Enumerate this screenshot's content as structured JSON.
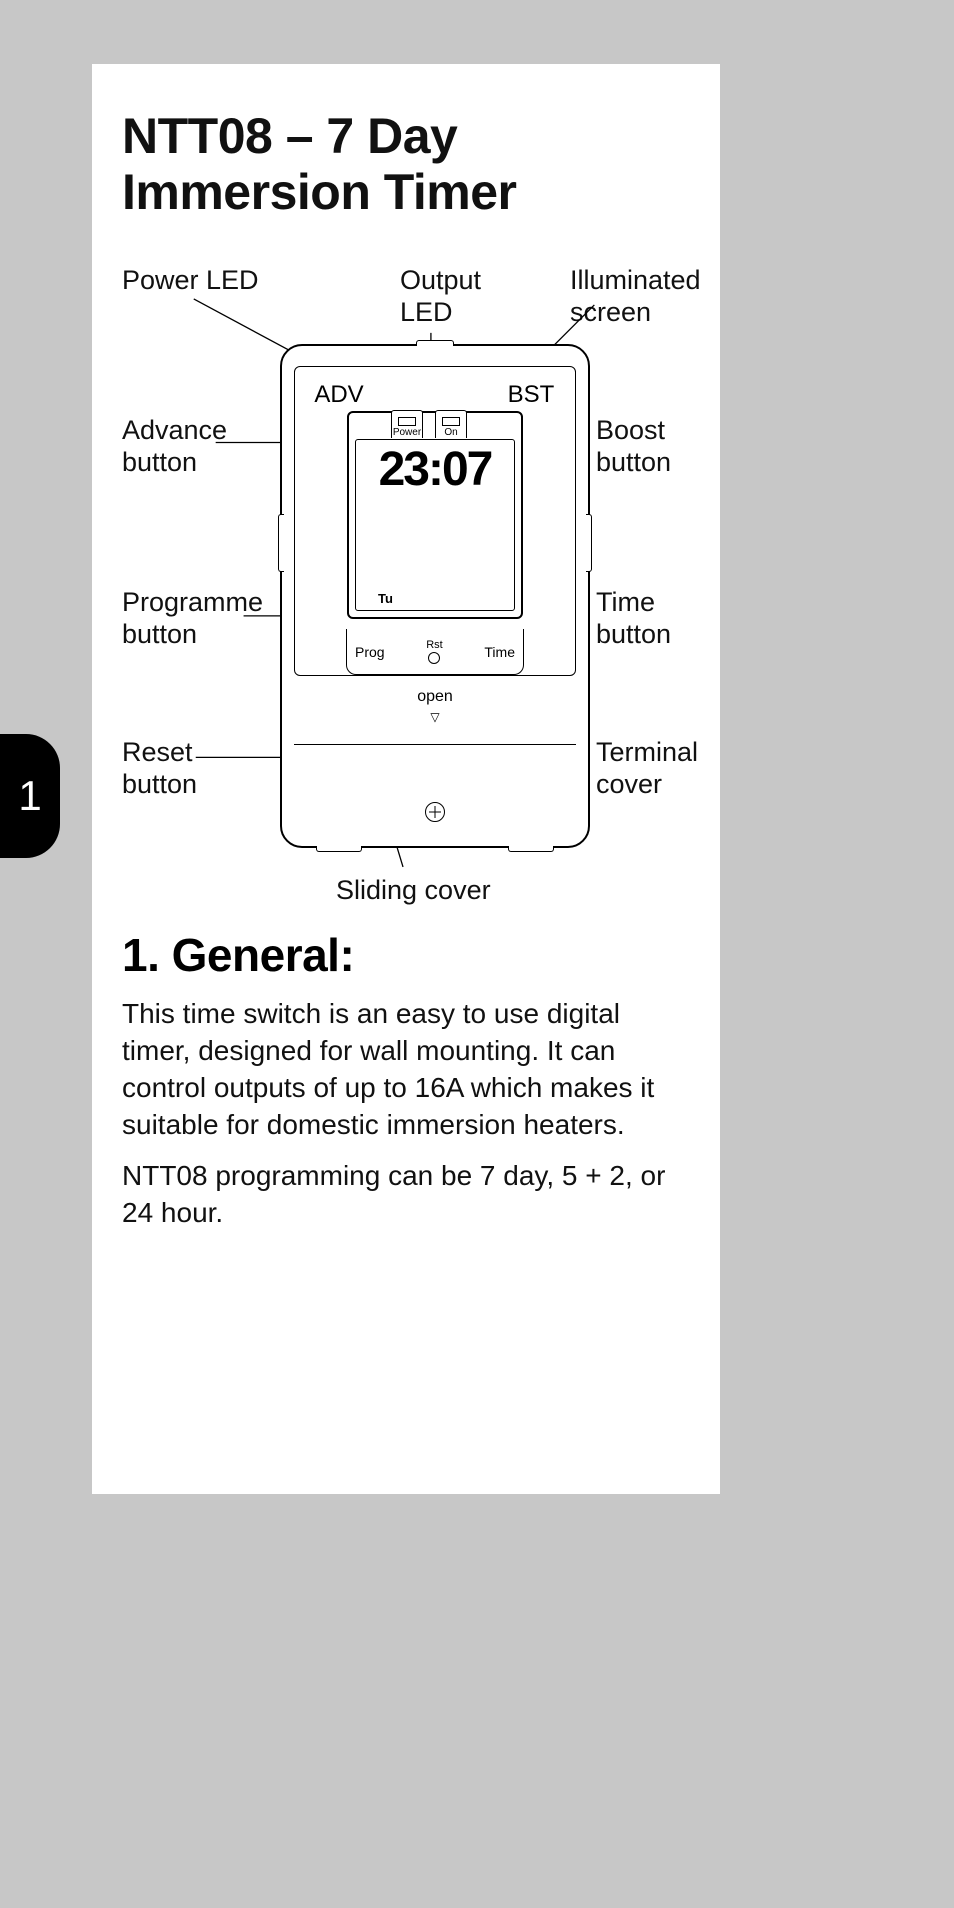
{
  "header": {
    "title": "NTT08 – 7 Day\nImmersion Timer"
  },
  "page_number": "1",
  "callouts": {
    "power_led": "Power LED",
    "output_led": "Output\nLED",
    "illuminated_screen": "Illuminated\nscreen",
    "advance_button": "Advance\nbutton",
    "boost_button": "Boost\nbutton",
    "programme_button": "Programme\nbutton",
    "time_button": "Time\nbutton",
    "reset_button": "Reset\nbutton",
    "terminal_cover": "Terminal\ncover",
    "sliding_cover": "Sliding cover"
  },
  "device": {
    "adv_label": "ADV",
    "bst_label": "BST",
    "power_led_label": "Power",
    "on_led_label": "On",
    "time_value": "23:07",
    "day_value": "Tu",
    "prog_label": "Prog",
    "rst_label": "Rst",
    "time_btn_label": "Time",
    "open_label": "open"
  },
  "section": {
    "heading": "1. General:",
    "p1": "This time switch is an easy to use digital timer, designed for wall mounting. It can control outputs of up to 16A which makes it suitable for domestic immersion heaters.",
    "p2": "NTT08 programming can be 7 day, 5 + 2, or 24 hour."
  }
}
